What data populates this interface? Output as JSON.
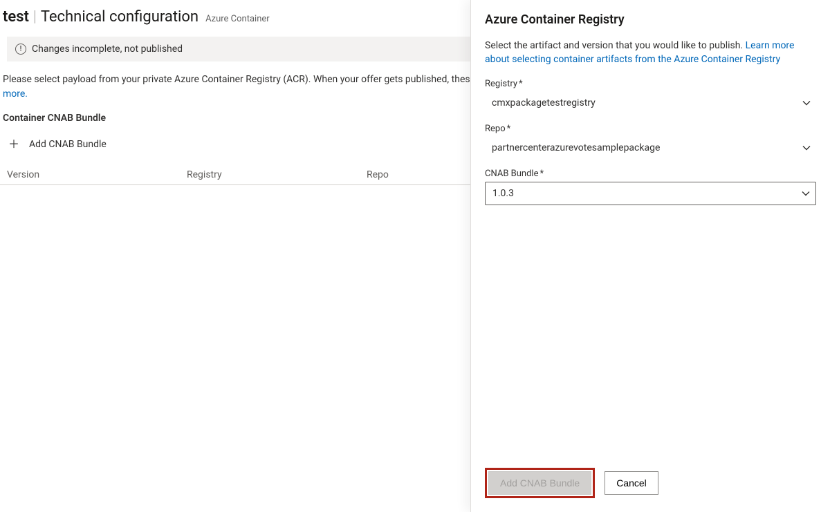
{
  "header": {
    "offer_name": "test",
    "separator": "|",
    "page_title": "Technical configuration",
    "subtitle": "Azure Container"
  },
  "status": {
    "message": "Changes incomplete, not published"
  },
  "intro": {
    "text_before_link": "Please select payload from your private Azure Container Registry (ACR). When your offer gets published, these artifacts will be copied to and served from the marketplace's public ACR. ",
    "link_text": "Learn more."
  },
  "section": {
    "title": "Container CNAB Bundle",
    "add_label": "Add CNAB Bundle"
  },
  "table": {
    "columns": [
      "Version",
      "Registry",
      "Repo"
    ]
  },
  "panel": {
    "title": "Azure Container Registry",
    "desc_before_link": "Select the artifact and version that you would like to publish. ",
    "desc_link": "Learn more about selecting container artifacts from the Azure Container Registry",
    "fields": {
      "registry": {
        "label": "Registry",
        "required": "*",
        "value": "cmxpackagetestregistry"
      },
      "repo": {
        "label": "Repo",
        "required": "*",
        "value": "partnercenterazurevotesamplepackage"
      },
      "bundle": {
        "label": "CNAB Bundle",
        "required": "*",
        "value": "1.0.3"
      }
    },
    "footer": {
      "add_label": "Add CNAB Bundle",
      "cancel_label": "Cancel"
    }
  }
}
